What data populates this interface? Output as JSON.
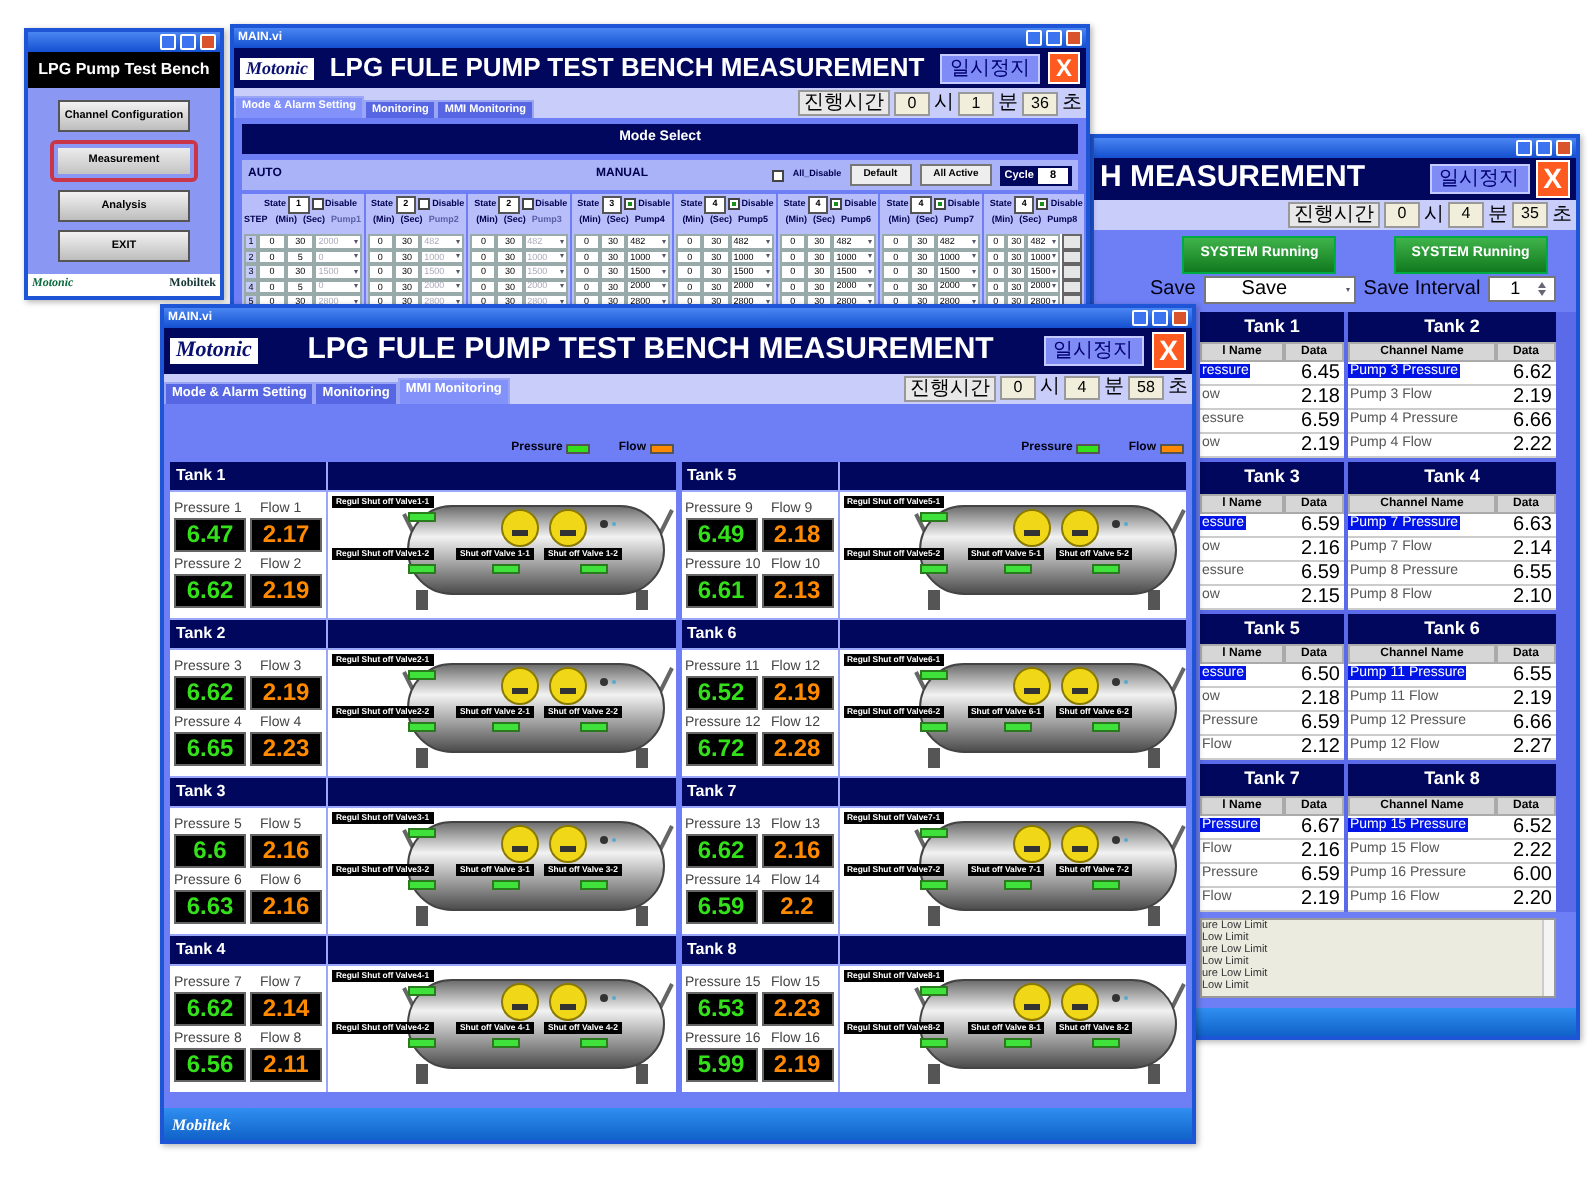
{
  "launcher": {
    "heading": "LPG Pump Test Bench",
    "buttons": [
      {
        "label": "Channel Configuration",
        "selected": false
      },
      {
        "label": "Measurement",
        "selected": true
      },
      {
        "label": "Analysis",
        "selected": false
      },
      {
        "label": "EXIT",
        "selected": false
      }
    ],
    "footer_left": "Motonic",
    "footer_right": "Mobiltek"
  },
  "setup_window": {
    "title": "MAIN.vi",
    "logo": "Motonic",
    "heading": "LPG FULE PUMP TEST BENCH MEASUREMENT",
    "pause_button": "일시정지",
    "close_button": "X",
    "tabs": [
      {
        "label": "Mode & Alarm Setting",
        "selected": true
      },
      {
        "label": "Monitoring",
        "selected": false
      },
      {
        "label": "MMI Monitoring",
        "selected": false
      }
    ],
    "elapsed": {
      "label": "진행시간",
      "hours": "0",
      "hours_unit": "시",
      "minutes": "1",
      "minutes_unit": "분",
      "seconds": "36",
      "seconds_unit": "초"
    },
    "section_title": "Mode Select",
    "auto_label": "AUTO",
    "manual_label": "MANUAL",
    "all_disable": {
      "label": "All_Disable",
      "checked": false
    },
    "default_button": "Default",
    "all_active_button": "All Active",
    "cycle": {
      "label": "Cycle",
      "value": "8"
    },
    "step_label": "STEP",
    "steps": [
      "1",
      "2",
      "3",
      "4",
      "5"
    ],
    "states": [
      {
        "state_label": "State",
        "state": "1",
        "disable_label": "Disable",
        "checked": false,
        "min_label": "(Min)",
        "sec_label": "(Sec)",
        "pump_label": "Pump1",
        "row_buttons": false,
        "rows": [
          {
            "min": "0",
            "sec": "30",
            "pump": "2000"
          },
          {
            "min": "0",
            "sec": "5",
            "pump": "0"
          },
          {
            "min": "0",
            "sec": "30",
            "pump": "1500"
          },
          {
            "min": "0",
            "sec": "5",
            "pump": "0"
          },
          {
            "min": "0",
            "sec": "30",
            "pump": "2800"
          }
        ]
      },
      {
        "state_label": "State",
        "state": "2",
        "disable_label": "Disable",
        "checked": false,
        "min_label": "(Min)",
        "sec_label": "(Sec)",
        "pump_label": "Pump2",
        "row_buttons": false,
        "rows": [
          {
            "min": "0",
            "sec": "30",
            "pump": "482"
          },
          {
            "min": "0",
            "sec": "30",
            "pump": "1000"
          },
          {
            "min": "0",
            "sec": "30",
            "pump": "1500"
          },
          {
            "min": "0",
            "sec": "30",
            "pump": "2000"
          },
          {
            "min": "0",
            "sec": "30",
            "pump": "2800"
          }
        ]
      },
      {
        "state_label": "State",
        "state": "2",
        "disable_label": "Disable",
        "checked": false,
        "min_label": "(Min)",
        "sec_label": "(Sec)",
        "pump_label": "Pump3",
        "row_buttons": false,
        "rows": [
          {
            "min": "0",
            "sec": "30",
            "pump": "482"
          },
          {
            "min": "0",
            "sec": "30",
            "pump": "1000"
          },
          {
            "min": "0",
            "sec": "30",
            "pump": "1500"
          },
          {
            "min": "0",
            "sec": "30",
            "pump": "2000"
          },
          {
            "min": "0",
            "sec": "30",
            "pump": "2800"
          }
        ]
      },
      {
        "state_label": "State",
        "state": "3",
        "disable_label": "Disable",
        "checked": true,
        "min_label": "(Min)",
        "sec_label": "(Sec)",
        "pump_label": "Pump4",
        "row_buttons": false,
        "rows": [
          {
            "min": "0",
            "sec": "30",
            "pump": "482"
          },
          {
            "min": "0",
            "sec": "30",
            "pump": "1000"
          },
          {
            "min": "0",
            "sec": "30",
            "pump": "1500"
          },
          {
            "min": "0",
            "sec": "30",
            "pump": "2000"
          },
          {
            "min": "0",
            "sec": "30",
            "pump": "2800"
          }
        ]
      },
      {
        "state_label": "State",
        "state": "4",
        "disable_label": "Disable",
        "checked": true,
        "min_label": "(Min)",
        "sec_label": "(Sec)",
        "pump_label": "Pump5",
        "row_buttons": false,
        "rows": [
          {
            "min": "0",
            "sec": "30",
            "pump": "482"
          },
          {
            "min": "0",
            "sec": "30",
            "pump": "1000"
          },
          {
            "min": "0",
            "sec": "30",
            "pump": "1500"
          },
          {
            "min": "0",
            "sec": "30",
            "pump": "2000"
          },
          {
            "min": "0",
            "sec": "30",
            "pump": "2800"
          }
        ]
      },
      {
        "state_label": "State",
        "state": "4",
        "disable_label": "Disable",
        "checked": true,
        "min_label": "(Min)",
        "sec_label": "(Sec)",
        "pump_label": "Pump6",
        "row_buttons": false,
        "rows": [
          {
            "min": "0",
            "sec": "30",
            "pump": "482"
          },
          {
            "min": "0",
            "sec": "30",
            "pump": "1000"
          },
          {
            "min": "0",
            "sec": "30",
            "pump": "1500"
          },
          {
            "min": "0",
            "sec": "30",
            "pump": "2000"
          },
          {
            "min": "0",
            "sec": "30",
            "pump": "2800"
          }
        ]
      },
      {
        "state_label": "State",
        "state": "4",
        "disable_label": "Disable",
        "checked": true,
        "min_label": "(Min)",
        "sec_label": "(Sec)",
        "pump_label": "Pump7",
        "row_buttons": false,
        "rows": [
          {
            "min": "0",
            "sec": "30",
            "pump": "482"
          },
          {
            "min": "0",
            "sec": "30",
            "pump": "1000"
          },
          {
            "min": "0",
            "sec": "30",
            "pump": "1500"
          },
          {
            "min": "0",
            "sec": "30",
            "pump": "2000"
          },
          {
            "min": "0",
            "sec": "30",
            "pump": "2800"
          }
        ]
      },
      {
        "state_label": "State",
        "state": "4",
        "disable_label": "Disable",
        "checked": true,
        "min_label": "(Min)",
        "sec_label": "(Sec)",
        "pump_label": "Pump8",
        "row_buttons": true,
        "rows": [
          {
            "min": "0",
            "sec": "30",
            "pump": "482"
          },
          {
            "min": "0",
            "sec": "30",
            "pump": "1000"
          },
          {
            "min": "0",
            "sec": "30",
            "pump": "1500"
          },
          {
            "min": "0",
            "sec": "30",
            "pump": "2000"
          },
          {
            "min": "0",
            "sec": "30",
            "pump": "2800"
          }
        ]
      }
    ]
  },
  "data_window": {
    "heading": "H MEASUREMENT",
    "pause_button": "일시정지",
    "close_button": "X",
    "elapsed": {
      "label": "진행시간",
      "hours": "0",
      "hours_unit": "시",
      "minutes": "4",
      "minutes_unit": "분",
      "seconds": "35",
      "seconds_unit": "초"
    },
    "status_buttons": [
      "SYSTEM Running",
      "SYSTEM Running"
    ],
    "save_label": "Save",
    "save_select": "Save",
    "interval_label": "Save Interval",
    "interval_value": "1",
    "tanks": [
      {
        "title": "Tank 1",
        "columns": [
          "l Name",
          "Data"
        ],
        "rows": [
          {
            "name": "ressure",
            "data": "6.45",
            "selected": true
          },
          {
            "name": "ow",
            "data": "2.18",
            "selected": false
          },
          {
            "name": "essure",
            "data": "6.59",
            "selected": false
          },
          {
            "name": "ow",
            "data": "2.19",
            "selected": false
          }
        ]
      },
      {
        "title": "Tank 2",
        "columns": [
          "Channel Name",
          "Data"
        ],
        "rows": [
          {
            "name": "Pump 3 Pressure",
            "data": "6.62",
            "selected": true
          },
          {
            "name": "Pump 3 Flow",
            "data": "2.19",
            "selected": false
          },
          {
            "name": "Pump 4 Pressure",
            "data": "6.66",
            "selected": false
          },
          {
            "name": "Pump 4 Flow",
            "data": "2.22",
            "selected": false
          }
        ]
      },
      {
        "title": "Tank 3",
        "columns": [
          "l Name",
          "Data"
        ],
        "rows": [
          {
            "name": "essure",
            "data": "6.59",
            "selected": true
          },
          {
            "name": "ow",
            "data": "2.16",
            "selected": false
          },
          {
            "name": "essure",
            "data": "6.59",
            "selected": false
          },
          {
            "name": "ow",
            "data": "2.15",
            "selected": false
          }
        ]
      },
      {
        "title": "Tank 4",
        "columns": [
          "Channel Name",
          "Data"
        ],
        "rows": [
          {
            "name": "Pump 7 Pressure",
            "data": "6.63",
            "selected": true
          },
          {
            "name": "Pump 7 Flow",
            "data": "2.14",
            "selected": false
          },
          {
            "name": "Pump 8 Pressure",
            "data": "6.55",
            "selected": false
          },
          {
            "name": "Pump 8 Flow",
            "data": "2.10",
            "selected": false
          }
        ]
      },
      {
        "title": "Tank 5",
        "columns": [
          "l Name",
          "Data"
        ],
        "rows": [
          {
            "name": "essure",
            "data": "6.50",
            "selected": true
          },
          {
            "name": "ow",
            "data": "2.18",
            "selected": false
          },
          {
            "name": "Pressure",
            "data": "6.59",
            "selected": false
          },
          {
            "name": "Flow",
            "data": "2.12",
            "selected": false
          }
        ]
      },
      {
        "title": "Tank 6",
        "columns": [
          "Channel Name",
          "Data"
        ],
        "rows": [
          {
            "name": "Pump 11 Pressure",
            "data": "6.55",
            "selected": true
          },
          {
            "name": "Pump 11 Flow",
            "data": "2.19",
            "selected": false
          },
          {
            "name": "Pump 12 Pressure",
            "data": "6.66",
            "selected": false
          },
          {
            "name": "Pump 12 Flow",
            "data": "2.27",
            "selected": false
          }
        ]
      },
      {
        "title": "Tank 7",
        "columns": [
          "l Name",
          "Data"
        ],
        "rows": [
          {
            "name": "Pressure",
            "data": "6.67",
            "selected": true
          },
          {
            "name": "Flow",
            "data": "2.16",
            "selected": false
          },
          {
            "name": "Pressure",
            "data": "6.59",
            "selected": false
          },
          {
            "name": "Flow",
            "data": "2.19",
            "selected": false
          }
        ]
      },
      {
        "title": "Tank 8",
        "columns": [
          "Channel Name",
          "Data"
        ],
        "rows": [
          {
            "name": "Pump 15 Pressure",
            "data": "6.52",
            "selected": true
          },
          {
            "name": "Pump 15 Flow",
            "data": "2.22",
            "selected": false
          },
          {
            "name": "Pump 16 Pressure",
            "data": "6.00",
            "selected": false
          },
          {
            "name": "Pump 16 Flow",
            "data": "2.20",
            "selected": false
          }
        ]
      }
    ],
    "log_lines": [
      "ure Low Limit",
      "Low Limit",
      "ure Low Limit",
      "Low Limit",
      "ure Low Limit",
      "Low Limit"
    ]
  },
  "monitor_window": {
    "title": "MAIN.vi",
    "logo": "Motonic",
    "heading": "LPG FULE PUMP TEST BENCH MEASUREMENT",
    "pause_button": "일시정지",
    "close_button": "X",
    "tabs": [
      {
        "label": "Mode & Alarm Setting",
        "selected": false
      },
      {
        "label": "Monitoring",
        "selected": false
      },
      {
        "label": "MMI Monitoring",
        "selected": true
      }
    ],
    "elapsed": {
      "label": "진행시간",
      "hours": "0",
      "hours_unit": "시",
      "minutes": "4",
      "minutes_unit": "분",
      "seconds": "58",
      "seconds_unit": "초"
    },
    "legend_groups": [
      [
        {
          "label": "Pressure",
          "color": "#33e01a"
        },
        {
          "label": "Flow",
          "color": "#ff8a00"
        }
      ],
      [
        {
          "label": "Pressure",
          "color": "#33e01a"
        },
        {
          "label": "Flow",
          "color": "#ff8a00"
        }
      ]
    ],
    "tanks": [
      {
        "title": "Tank 1",
        "gauges": [
          {
            "pressure_label": "Pressure 1",
            "flow_label": "Flow 1",
            "pressure": "6.47",
            "flow": "2.17"
          },
          {
            "pressure_label": "Pressure 2",
            "flow_label": "Flow 2",
            "pressure": "6.62",
            "flow": "2.19"
          }
        ],
        "valves": [
          {
            "label": "Regul Shut off Valve1-1",
            "on": true
          },
          {
            "label": "Regul Shut off Valve1-2",
            "on": true
          },
          {
            "label": "Shut off Valve 1-1",
            "on": true
          },
          {
            "label": "Shut off Valve 1-2",
            "on": true
          }
        ]
      },
      {
        "title": "Tank 2",
        "gauges": [
          {
            "pressure_label": "Pressure 3",
            "flow_label": "Flow 3",
            "pressure": "6.62",
            "flow": "2.19"
          },
          {
            "pressure_label": "Pressure 4",
            "flow_label": "Flow 4",
            "pressure": "6.65",
            "flow": "2.23"
          }
        ],
        "valves": [
          {
            "label": "Regul Shut off Valve2-1",
            "on": true
          },
          {
            "label": "Regul Shut off Valve2-2",
            "on": true
          },
          {
            "label": "Shut off Valve 2-1",
            "on": true
          },
          {
            "label": "Shut off Valve 2-2",
            "on": true
          }
        ]
      },
      {
        "title": "Tank 3",
        "gauges": [
          {
            "pressure_label": "Pressure 5",
            "flow_label": "Flow 5",
            "pressure": "6.6",
            "flow": "2.16"
          },
          {
            "pressure_label": "Pressure 6",
            "flow_label": "Flow 6",
            "pressure": "6.63",
            "flow": "2.16"
          }
        ],
        "valves": [
          {
            "label": "Regul Shut off Valve3-1",
            "on": true
          },
          {
            "label": "Regul Shut off Valve3-2",
            "on": true
          },
          {
            "label": "Shut off Valve 3-1",
            "on": true
          },
          {
            "label": "Shut off Valve 3-2",
            "on": true
          }
        ]
      },
      {
        "title": "Tank 4",
        "gauges": [
          {
            "pressure_label": "Pressure 7",
            "flow_label": "Flow 7",
            "pressure": "6.62",
            "flow": "2.14"
          },
          {
            "pressure_label": "Pressure 8",
            "flow_label": "Flow 8",
            "pressure": "6.56",
            "flow": "2.11"
          }
        ],
        "valves": [
          {
            "label": "Regul Shut off Valve4-1",
            "on": true
          },
          {
            "label": "Regul Shut off Valve4-2",
            "on": true
          },
          {
            "label": "Shut off Valve 4-1",
            "on": true
          },
          {
            "label": "Shut off Valve 4-2",
            "on": true
          }
        ]
      },
      {
        "title": "Tank 5",
        "gauges": [
          {
            "pressure_label": "Pressure 9",
            "flow_label": "Flow 9",
            "pressure": "6.49",
            "flow": "2.18"
          },
          {
            "pressure_label": "Pressure 10",
            "flow_label": "Flow 10",
            "pressure": "6.61",
            "flow": "2.13"
          }
        ],
        "valves": [
          {
            "label": "Regul Shut off Valve5-1",
            "on": true
          },
          {
            "label": "Regul Shut off Valve5-2",
            "on": true
          },
          {
            "label": "Shut off Valve 5-1",
            "on": true
          },
          {
            "label": "Shut off Valve 5-2",
            "on": true
          }
        ]
      },
      {
        "title": "Tank 6",
        "gauges": [
          {
            "pressure_label": "Pressure 11",
            "flow_label": "Flow 12",
            "pressure": "6.52",
            "flow": "2.19"
          },
          {
            "pressure_label": "Pressure 12",
            "flow_label": "Flow 12",
            "pressure": "6.72",
            "flow": "2.28"
          }
        ],
        "valves": [
          {
            "label": "Regul Shut off Valve6-1",
            "on": true
          },
          {
            "label": "Regul Shut off Valve6-2",
            "on": true
          },
          {
            "label": "Shut off Valve 6-1",
            "on": true
          },
          {
            "label": "Shut off Valve 6-2",
            "on": true
          }
        ]
      },
      {
        "title": "Tank 7",
        "gauges": [
          {
            "pressure_label": "Pressure 13",
            "flow_label": "Flow 13",
            "pressure": "6.62",
            "flow": "2.16"
          },
          {
            "pressure_label": "Pressure 14",
            "flow_label": "Flow 14",
            "pressure": "6.59",
            "flow": "2.2"
          }
        ],
        "valves": [
          {
            "label": "Regul Shut off Valve7-1",
            "on": true
          },
          {
            "label": "Regul Shut off Valve7-2",
            "on": true
          },
          {
            "label": "Shut off Valve 7-1",
            "on": true
          },
          {
            "label": "Shut off Valve 7-2",
            "on": true
          }
        ]
      },
      {
        "title": "Tank 8",
        "gauges": [
          {
            "pressure_label": "Pressure 15",
            "flow_label": "Flow 15",
            "pressure": "6.53",
            "flow": "2.23"
          },
          {
            "pressure_label": "Pressure 16",
            "flow_label": "Flow 16",
            "pressure": "5.99",
            "flow": "2.19"
          }
        ],
        "valves": [
          {
            "label": "Regul Shut off Valve8-1",
            "on": true
          },
          {
            "label": "Regul Shut off Valve8-2",
            "on": true
          },
          {
            "label": "Shut off Valve 8-1",
            "on": true
          },
          {
            "label": "Shut off Valve 8-2",
            "on": true
          }
        ]
      }
    ],
    "footer": "Mobiltek"
  }
}
